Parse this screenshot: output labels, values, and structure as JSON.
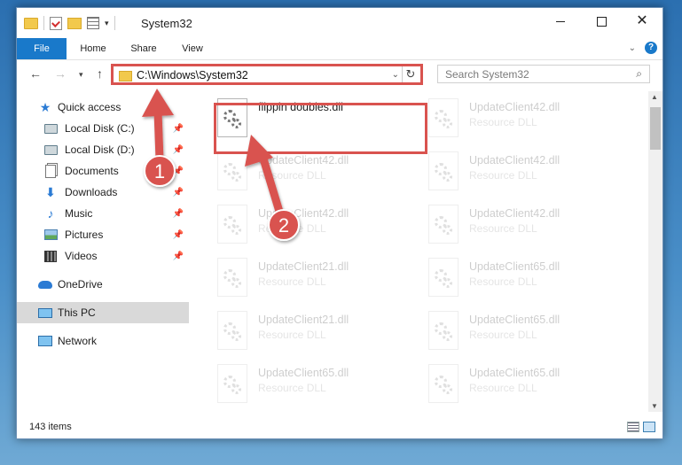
{
  "window": {
    "title": "System32",
    "controls": {
      "minimize": "minimize",
      "maximize": "maximize",
      "close": "close"
    }
  },
  "ribbon": {
    "tabs": [
      {
        "label": "File",
        "active": true
      },
      {
        "label": "Home"
      },
      {
        "label": "Share"
      },
      {
        "label": "View"
      }
    ],
    "help": "?"
  },
  "nav": {
    "address": "C:\\Windows\\System32",
    "search_placeholder": "Search System32"
  },
  "sidebar": {
    "items": [
      {
        "label": "Quick access",
        "icon": "star-icon"
      },
      {
        "label": "Local Disk (C:)",
        "icon": "drive-icon",
        "pinned": true
      },
      {
        "label": "Local Disk (D:)",
        "icon": "drive-icon",
        "pinned": true
      },
      {
        "label": "Documents",
        "icon": "documents-icon",
        "pinned": true
      },
      {
        "label": "Downloads",
        "icon": "downloads-icon",
        "pinned": true
      },
      {
        "label": "Music",
        "icon": "music-icon",
        "pinned": true
      },
      {
        "label": "Pictures",
        "icon": "pictures-icon",
        "pinned": true
      },
      {
        "label": "Videos",
        "icon": "videos-icon",
        "pinned": true
      },
      {
        "label": "OneDrive",
        "icon": "onedrive-icon"
      },
      {
        "label": "This PC",
        "icon": "this-pc-icon",
        "selected": true
      },
      {
        "label": "Network",
        "icon": "network-icon"
      }
    ]
  },
  "files": [
    {
      "name": "flippin doubles.dll",
      "type": ""
    },
    {
      "name": "UpdateClient42.dll",
      "type": "Resource DLL"
    },
    {
      "name": "UpdateClient42.dll",
      "type": "Resource DLL"
    },
    {
      "name": "UpdateClient42.dll",
      "type": "Resource DLL"
    },
    {
      "name": "UpdateClient42.dll",
      "type": "Resource DLL"
    },
    {
      "name": "UpdateClient42.dll",
      "type": "Resource DLL"
    },
    {
      "name": "UpdateClient21.dll",
      "type": "Resource DLL"
    },
    {
      "name": "UpdateClient65.dll",
      "type": "Resource DLL"
    },
    {
      "name": "UpdateClient21.dll",
      "type": "Resource DLL"
    },
    {
      "name": "UpdateClient65.dll",
      "type": "Resource DLL"
    },
    {
      "name": "UpdateClient65.dll",
      "type": "Resource DLL"
    },
    {
      "name": "UpdateClient65.dll",
      "type": "Resource DLL"
    }
  ],
  "status": {
    "item_count": "143 items"
  },
  "annotations": [
    {
      "number": "1",
      "color": "#d9534f"
    },
    {
      "number": "2",
      "color": "#d9534f"
    }
  ]
}
